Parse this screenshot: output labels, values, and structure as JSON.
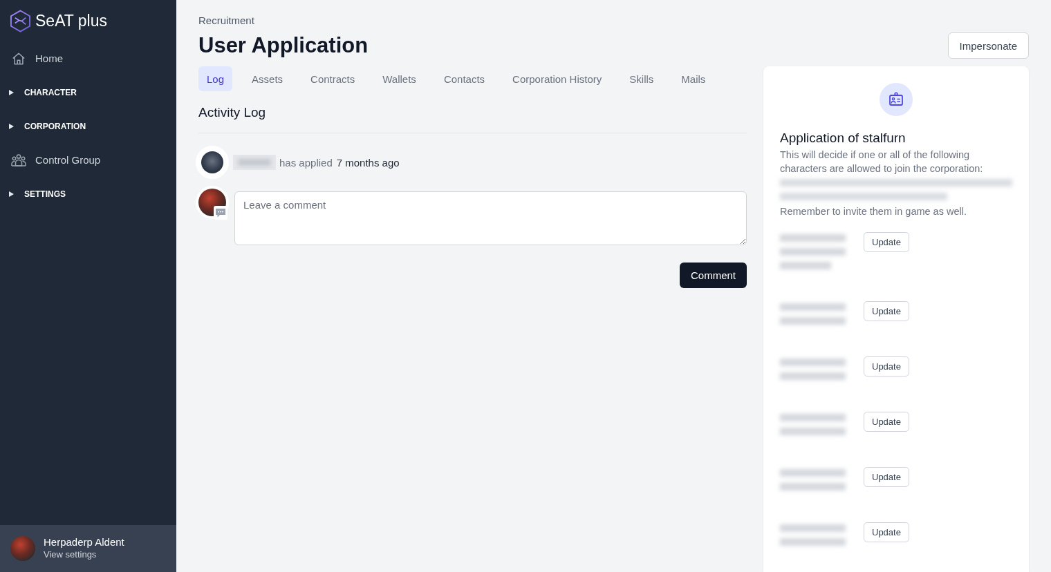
{
  "sidebar": {
    "brand": "SeAT plus",
    "items": [
      {
        "kind": "home",
        "label": "Home"
      },
      {
        "kind": "section",
        "label": "CHARACTER",
        "expanded": false
      },
      {
        "kind": "section",
        "label": "CORPORATION",
        "expanded": false
      },
      {
        "kind": "group",
        "label": "Control Group"
      },
      {
        "kind": "section",
        "label": "SETTINGS",
        "expanded": false
      }
    ],
    "user": {
      "name": "Herpaderp Aldent",
      "link": "View settings"
    }
  },
  "header": {
    "breadcrumb": "Recruitment",
    "title": "User Application",
    "action": "Impersonate"
  },
  "tabs": [
    {
      "label": "Log",
      "selected": true
    },
    {
      "label": "Assets",
      "selected": false
    },
    {
      "label": "Contracts",
      "selected": false
    },
    {
      "label": "Wallets",
      "selected": false
    },
    {
      "label": "Contacts",
      "selected": false
    },
    {
      "label": "Corporation History",
      "selected": false
    },
    {
      "label": "Skills",
      "selected": false
    },
    {
      "label": "Mails",
      "selected": false
    }
  ],
  "activity": {
    "heading": "Activity Log",
    "entries": [
      {
        "action": "has applied",
        "time": "7 months ago"
      }
    ],
    "comment": {
      "placeholder": "Leave a comment",
      "button": "Comment"
    }
  },
  "application": {
    "title": "Application of stalfurn",
    "description": "This will decide if one or all of the following characters are allowed to join the corporation:",
    "reminder": "Remember to invite them in game as well.",
    "characters": [
      {
        "button": "Update"
      },
      {
        "button": "Update"
      },
      {
        "button": "Update"
      },
      {
        "button": "Update"
      },
      {
        "button": "Update"
      },
      {
        "button": "Update"
      }
    ]
  }
}
